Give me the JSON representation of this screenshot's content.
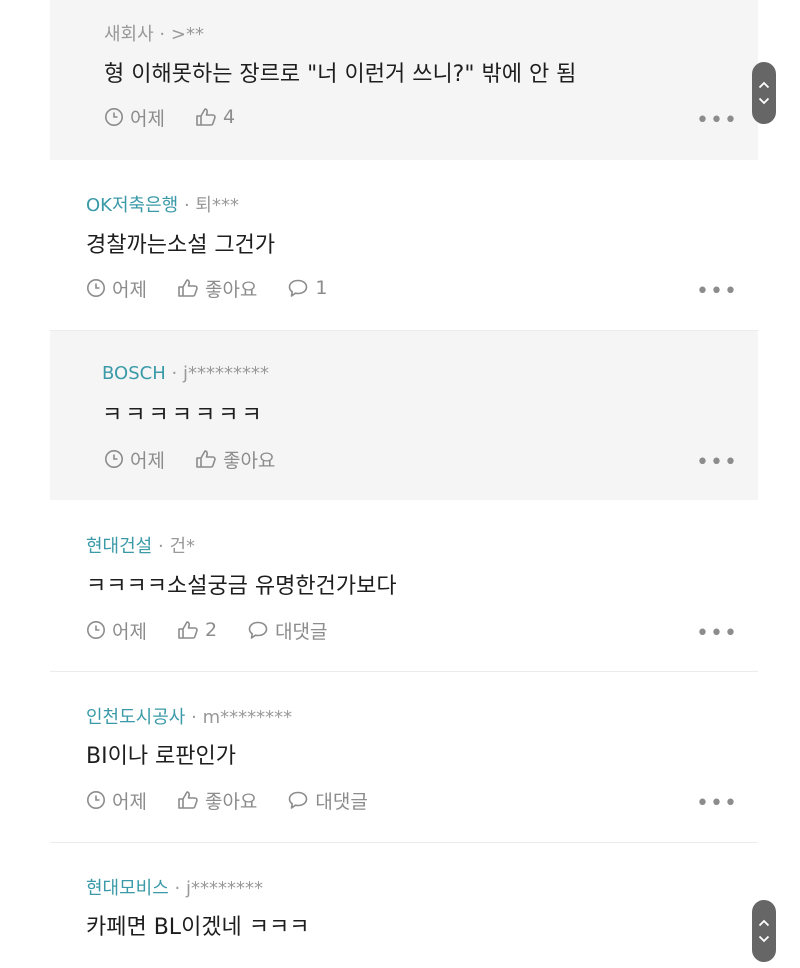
{
  "comments": [
    {
      "company": "새회사",
      "user": ">**",
      "text": "형 이해못하는 장르로 \"너 이런거 쓰니?\" 밖에 안 됨",
      "time": "어제",
      "like": "4"
    },
    {
      "company": "OK저축은행",
      "user": "퇴***",
      "text": "경찰까는소설 그건가",
      "time": "어제",
      "like": "좋아요",
      "reply": "1"
    },
    {
      "company": "BOSCH",
      "user": "j*********",
      "text": "ㅋㅋㅋㅋㅋㅋㅋ",
      "time": "어제",
      "like": "좋아요"
    },
    {
      "company": "현대건설",
      "user": "건*",
      "text": "ㅋㅋㅋㅋ소설궁금 유명한건가보다",
      "time": "어제",
      "like": "2",
      "reply": "대댓글"
    },
    {
      "company": "인천도시공사",
      "user": "m********",
      "text": "BI이나 로판인가",
      "time": "어제",
      "like": "좋아요",
      "reply": "대댓글"
    },
    {
      "company": "현대모비스",
      "user": "j********",
      "text": "카페면 BL이겠네 ㅋㅋㅋ"
    }
  ],
  "separator": "·",
  "more_label": "•••"
}
